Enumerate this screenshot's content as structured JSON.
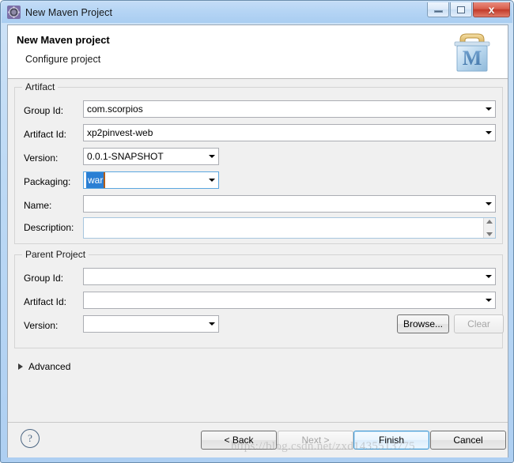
{
  "window": {
    "title": "New Maven Project",
    "title_icon": "eclipse-gear-icon",
    "controls": {
      "minimize": "minimize-icon",
      "maximize": "maximize-icon",
      "close": "x"
    }
  },
  "header": {
    "title": "New Maven project",
    "subtitle": "Configure project",
    "logo_letter": "M",
    "logo_name": "maven-logo"
  },
  "artifact": {
    "legend": "Artifact",
    "fields": [
      {
        "label": "Group Id:",
        "value": "com.scorpios"
      },
      {
        "label": "Artifact Id:",
        "value": "xp2pinvest-web"
      },
      {
        "label": "Version:",
        "value": "0.0.1-SNAPSHOT"
      },
      {
        "label": "Packaging:",
        "value": "war"
      },
      {
        "label": "Name:",
        "value": ""
      },
      {
        "label": "Description:",
        "value": ""
      }
    ]
  },
  "parent_project": {
    "legend": "Parent Project",
    "fields": [
      {
        "label": "Group Id:",
        "value": ""
      },
      {
        "label": "Artifact Id:",
        "value": ""
      },
      {
        "label": "Version:",
        "value": ""
      }
    ],
    "browse_label": "Browse...",
    "clear_label": "Clear"
  },
  "advanced": {
    "label": "Advanced",
    "expanded": false
  },
  "footer": {
    "help": "?",
    "back_label": "< Back",
    "next_label": "Next >",
    "finish_label": "Finish",
    "cancel_label": "Cancel"
  },
  "watermark": {
    "text": "https://blog.csdn.net/zxd1435513775"
  },
  "colors": {
    "titlebar": "#b4d4f4",
    "dialog_bg": "#f0f0f0",
    "selection_blue": "#2a7fd4",
    "default_button_border": "#3c97d3",
    "close_button_red": "#c23b2a"
  }
}
